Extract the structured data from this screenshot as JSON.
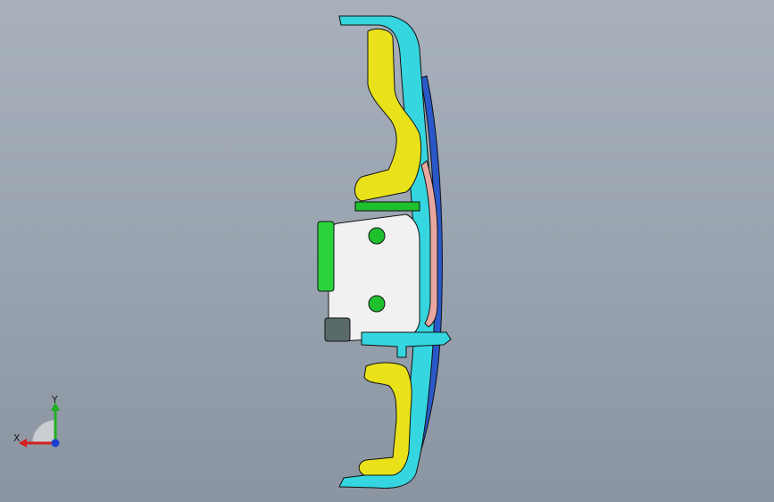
{
  "viewport": {
    "background_top": "#a7b0bb",
    "background_bottom": "#8b95a2"
  },
  "model": {
    "part_colors": {
      "cyan": "#35d6df",
      "yellow": "#e9e21a",
      "green": "#1fbf2e",
      "white": "#f1f1f1",
      "blue": "#2a58c9",
      "pink": "#e7a7a0",
      "outline": "#111111"
    }
  },
  "triad": {
    "x_label": "X",
    "y_label": "Y",
    "x_color": "#d42020",
    "y_color": "#22b022",
    "z_color": "#1c3fd0"
  }
}
